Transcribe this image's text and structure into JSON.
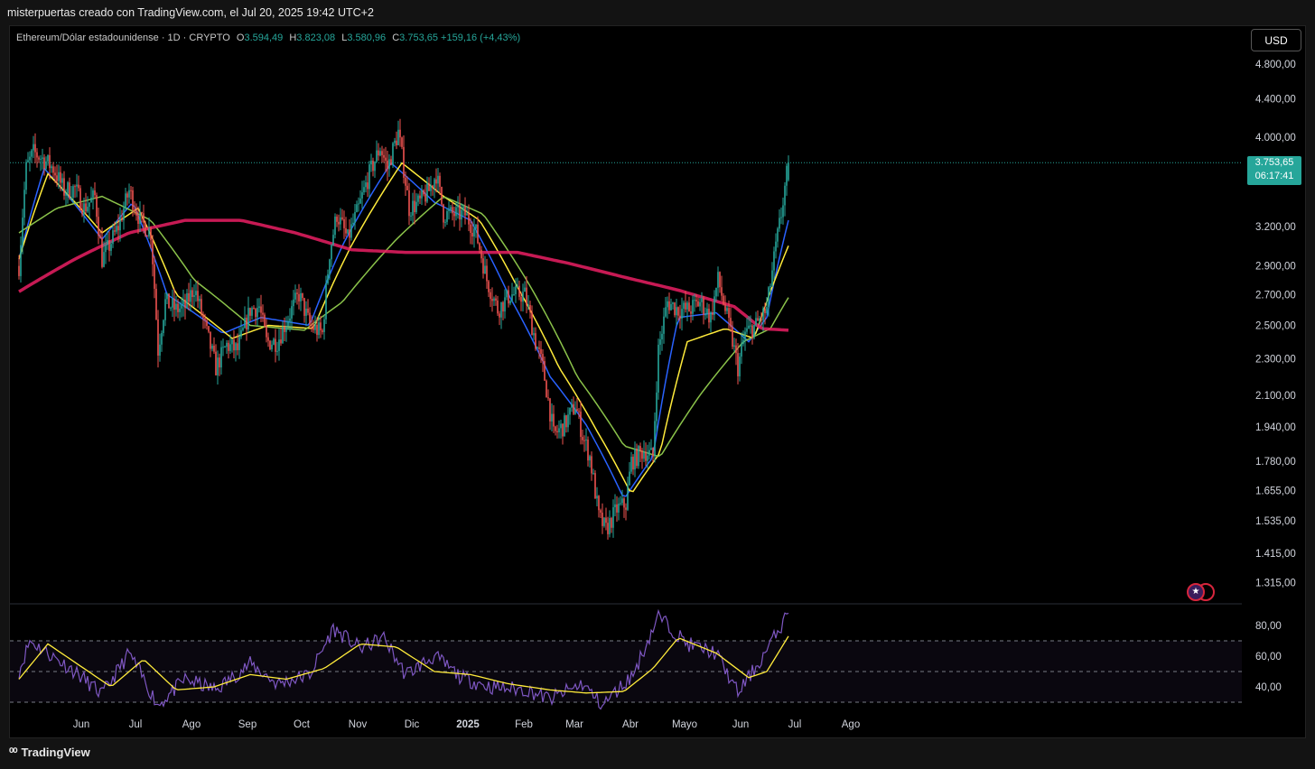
{
  "header": {
    "caption": "misterpuertas creado con TradingView.com, el Jul 20, 2025 19:42 UTC+2"
  },
  "legend": {
    "symbol": "Ethereum/Dólar estadounidense · 1D · CRYPTO",
    "open_key": "O",
    "open": "3.594,49",
    "high_key": "H",
    "high": "3.823,08",
    "low_key": "L",
    "low": "3.580,96",
    "close_key": "C",
    "close": "3.753,65",
    "change": "+159,16 (+4,43%)"
  },
  "toolbar": {
    "currency_label": "USD"
  },
  "last_price": {
    "price": "3.753,65",
    "countdown": "06:17:41",
    "color": "#26a69a"
  },
  "footer": {
    "brand": "TradingView"
  },
  "icons": {
    "event_flag": "us-flag-icon",
    "brand_mark": "tradingview-logo-icon"
  },
  "colors": {
    "up": "#26a69a",
    "down": "#ef5350",
    "ma_fast": "#2962ff",
    "ma_mid": "#ffeb3b",
    "ma_slow": "#8bc34a",
    "ma_long": "#e91e63",
    "rsi": "#7e57c2",
    "rsi_ma": "#ffeb3b"
  },
  "chart_data": {
    "type": "candlestick",
    "price_scale": "log",
    "y_ticks": [
      "4.800,00",
      "4.400,00",
      "4.000,00",
      "3.200,00",
      "2.900,00",
      "2.700,00",
      "2.500,00",
      "2.300,00",
      "2.100,00",
      "1.940,00",
      "1.780,00",
      "1.655,00",
      "1.535,00",
      "1.415,00",
      "1.315,00"
    ],
    "y_tick_values": [
      4800,
      4400,
      4000,
      3200,
      2900,
      2700,
      2500,
      2300,
      2100,
      1940,
      1780,
      1655,
      1535,
      1415,
      1315
    ],
    "x_ticks": [
      "Jun",
      "Jul",
      "Ago",
      "Sep",
      "Oct",
      "Nov",
      "Dic",
      "2025",
      "Feb",
      "Mar",
      "Abr",
      "Mayo",
      "Jun",
      "Jul",
      "Ago"
    ],
    "price_path": [
      [
        "2024-05-20",
        2900
      ],
      [
        "2024-05-24",
        3700
      ],
      [
        "2024-05-28",
        3850
      ],
      [
        "2024-06-03",
        3780
      ],
      [
        "2024-06-08",
        3700
      ],
      [
        "2024-06-14",
        3500
      ],
      [
        "2024-06-20",
        3520
      ],
      [
        "2024-06-25",
        3350
      ],
      [
        "2024-07-01",
        3450
      ],
      [
        "2024-07-05",
        2950
      ],
      [
        "2024-07-09",
        3050
      ],
      [
        "2024-07-14",
        3200
      ],
      [
        "2024-07-20",
        3500
      ],
      [
        "2024-07-26",
        3250
      ],
      [
        "2024-08-01",
        3150
      ],
      [
        "2024-08-05",
        2350
      ],
      [
        "2024-08-09",
        2650
      ],
      [
        "2024-08-15",
        2600
      ],
      [
        "2024-08-20",
        2620
      ],
      [
        "2024-08-25",
        2750
      ],
      [
        "2024-09-01",
        2450
      ],
      [
        "2024-09-06",
        2250
      ],
      [
        "2024-09-12",
        2380
      ],
      [
        "2024-09-18",
        2350
      ],
      [
        "2024-09-25",
        2600
      ],
      [
        "2024-09-30",
        2620
      ],
      [
        "2024-10-04",
        2400
      ],
      [
        "2024-10-10",
        2400
      ],
      [
        "2024-10-16",
        2550
      ],
      [
        "2024-10-22",
        2700
      ],
      [
        "2024-10-28",
        2500
      ],
      [
        "2024-11-04",
        2450
      ],
      [
        "2024-11-08",
        3000
      ],
      [
        "2024-11-12",
        3300
      ],
      [
        "2024-11-18",
        3100
      ],
      [
        "2024-11-24",
        3350
      ],
      [
        "2024-11-30",
        3650
      ],
      [
        "2024-12-06",
        3900
      ],
      [
        "2024-12-10",
        3700
      ],
      [
        "2024-12-16",
        4050
      ],
      [
        "2024-12-22",
        3350
      ],
      [
        "2024-12-28",
        3400
      ],
      [
        "2025-01-02",
        3500
      ],
      [
        "2025-01-06",
        3650
      ],
      [
        "2025-01-10",
        3300
      ],
      [
        "2025-01-16",
        3300
      ],
      [
        "2025-01-22",
        3300
      ],
      [
        "2025-01-28",
        3150
      ],
      [
        "2025-02-03",
        2800
      ],
      [
        "2025-02-09",
        2600
      ],
      [
        "2025-02-16",
        2700
      ],
      [
        "2025-02-24",
        2700
      ],
      [
        "2025-03-02",
        2400
      ],
      [
        "2025-03-06",
        2250
      ],
      [
        "2025-03-12",
        1900
      ],
      [
        "2025-03-18",
        1950
      ],
      [
        "2025-03-24",
        2050
      ],
      [
        "2025-03-28",
        1900
      ],
      [
        "2025-04-01",
        1800
      ],
      [
        "2025-04-06",
        1550
      ],
      [
        "2025-04-10",
        1500
      ],
      [
        "2025-04-16",
        1580
      ],
      [
        "2025-04-21",
        1600
      ],
      [
        "2025-04-24",
        1780
      ],
      [
        "2025-05-01",
        1830
      ],
      [
        "2025-05-06",
        1800
      ],
      [
        "2025-05-09",
        2350
      ],
      [
        "2025-05-14",
        2650
      ],
      [
        "2025-05-20",
        2600
      ],
      [
        "2025-05-26",
        2600
      ],
      [
        "2025-06-01",
        2650
      ],
      [
        "2025-06-07",
        2550
      ],
      [
        "2025-06-11",
        2800
      ],
      [
        "2025-06-17",
        2500
      ],
      [
        "2025-06-22",
        2250
      ],
      [
        "2025-06-26",
        2450
      ],
      [
        "2025-07-02",
        2500
      ],
      [
        "2025-07-08",
        2600
      ],
      [
        "2025-07-12",
        2950
      ],
      [
        "2025-07-16",
        3300
      ],
      [
        "2025-07-20",
        3753.65
      ]
    ],
    "moving_averages": [
      {
        "color": "#2962ff",
        "path": [
          [
            "2024-05-20",
            2950
          ],
          [
            "2024-06-03",
            3700
          ],
          [
            "2024-07-05",
            3100
          ],
          [
            "2024-07-22",
            3400
          ],
          [
            "2024-08-10",
            2700
          ],
          [
            "2024-09-10",
            2450
          ],
          [
            "2024-10-01",
            2550
          ],
          [
            "2024-10-28",
            2500
          ],
          [
            "2024-11-15",
            3050
          ],
          [
            "2024-12-12",
            3750
          ],
          [
            "2025-01-05",
            3400
          ],
          [
            "2025-01-25",
            3250
          ],
          [
            "2025-02-15",
            2700
          ],
          [
            "2025-03-10",
            2200
          ],
          [
            "2025-03-30",
            1950
          ],
          [
            "2025-04-20",
            1620
          ],
          [
            "2025-05-06",
            1800
          ],
          [
            "2025-05-20",
            2550
          ],
          [
            "2025-06-10",
            2580
          ],
          [
            "2025-06-28",
            2400
          ],
          [
            "2025-07-08",
            2550
          ],
          [
            "2025-07-20",
            3250
          ]
        ]
      },
      {
        "color": "#ffeb3b",
        "path": [
          [
            "2024-05-20",
            2950
          ],
          [
            "2024-06-05",
            3650
          ],
          [
            "2024-07-05",
            3150
          ],
          [
            "2024-07-25",
            3350
          ],
          [
            "2024-08-15",
            2700
          ],
          [
            "2024-09-15",
            2420
          ],
          [
            "2024-10-05",
            2500
          ],
          [
            "2024-10-30",
            2480
          ],
          [
            "2024-11-20",
            3050
          ],
          [
            "2024-12-18",
            3750
          ],
          [
            "2025-01-10",
            3450
          ],
          [
            "2025-01-30",
            3250
          ],
          [
            "2025-02-20",
            2750
          ],
          [
            "2025-03-15",
            2250
          ],
          [
            "2025-04-05",
            1920
          ],
          [
            "2025-04-24",
            1640
          ],
          [
            "2025-05-10",
            1820
          ],
          [
            "2025-05-25",
            2400
          ],
          [
            "2025-06-15",
            2480
          ],
          [
            "2025-07-01",
            2420
          ],
          [
            "2025-07-20",
            3050
          ]
        ]
      },
      {
        "color": "#8bc34a",
        "path": [
          [
            "2024-05-20",
            3150
          ],
          [
            "2024-06-10",
            3350
          ],
          [
            "2024-07-05",
            3450
          ],
          [
            "2024-08-01",
            3250
          ],
          [
            "2024-08-25",
            2800
          ],
          [
            "2024-09-25",
            2500
          ],
          [
            "2024-10-25",
            2470
          ],
          [
            "2024-11-15",
            2650
          ],
          [
            "2024-12-15",
            3100
          ],
          [
            "2025-01-10",
            3450
          ],
          [
            "2025-02-01",
            3300
          ],
          [
            "2025-02-25",
            2800
          ],
          [
            "2025-03-25",
            2200
          ],
          [
            "2025-04-20",
            1850
          ],
          [
            "2025-05-10",
            1800
          ],
          [
            "2025-06-01",
            2100
          ],
          [
            "2025-06-25",
            2400
          ],
          [
            "2025-07-10",
            2480
          ],
          [
            "2025-07-20",
            2680
          ]
        ]
      },
      {
        "color": "#e91e63",
        "path": [
          [
            "2024-05-20",
            2720
          ],
          [
            "2024-06-20",
            2950
          ],
          [
            "2024-07-20",
            3150
          ],
          [
            "2024-08-20",
            3250
          ],
          [
            "2024-09-20",
            3250
          ],
          [
            "2024-10-20",
            3150
          ],
          [
            "2024-11-20",
            3020
          ],
          [
            "2024-12-20",
            3000
          ],
          [
            "2025-01-20",
            3000
          ],
          [
            "2025-02-20",
            3000
          ],
          [
            "2025-03-20",
            2920
          ],
          [
            "2025-04-20",
            2820
          ],
          [
            "2025-05-20",
            2730
          ],
          [
            "2025-06-20",
            2620
          ],
          [
            "2025-07-05",
            2480
          ],
          [
            "2025-07-20",
            2470
          ]
        ]
      }
    ],
    "rsi": {
      "y_ticks": [
        "80,00",
        "60,00",
        "40,00"
      ],
      "y_tick_values": [
        80,
        60,
        40
      ],
      "bands": [
        70,
        50,
        30
      ],
      "path": [
        [
          "2024-05-20",
          50
        ],
        [
          "2024-05-26",
          70
        ],
        [
          "2024-06-05",
          62
        ],
        [
          "2024-06-20",
          50
        ],
        [
          "2024-07-05",
          35
        ],
        [
          "2024-07-20",
          62
        ],
        [
          "2024-08-05",
          28
        ],
        [
          "2024-08-20",
          45
        ],
        [
          "2024-09-06",
          38
        ],
        [
          "2024-09-25",
          55
        ],
        [
          "2024-10-10",
          42
        ],
        [
          "2024-10-28",
          48
        ],
        [
          "2024-11-10",
          78
        ],
        [
          "2024-11-25",
          65
        ],
        [
          "2024-12-08",
          72
        ],
        [
          "2024-12-20",
          48
        ],
        [
          "2025-01-05",
          60
        ],
        [
          "2025-01-20",
          46
        ],
        [
          "2025-02-05",
          40
        ],
        [
          "2025-02-25",
          38
        ],
        [
          "2025-03-10",
          32
        ],
        [
          "2025-03-28",
          42
        ],
        [
          "2025-04-08",
          28
        ],
        [
          "2025-04-25",
          48
        ],
        [
          "2025-05-09",
          86
        ],
        [
          "2025-05-25",
          68
        ],
        [
          "2025-06-10",
          62
        ],
        [
          "2025-06-22",
          36
        ],
        [
          "2025-07-05",
          58
        ],
        [
          "2025-07-20",
          88
        ]
      ],
      "ma_path": [
        [
          "2024-05-20",
          45
        ],
        [
          "2024-06-05",
          68
        ],
        [
          "2024-06-25",
          52
        ],
        [
          "2024-07-10",
          40
        ],
        [
          "2024-07-28",
          58
        ],
        [
          "2024-08-15",
          38
        ],
        [
          "2024-09-05",
          40
        ],
        [
          "2024-09-25",
          48
        ],
        [
          "2024-10-15",
          45
        ],
        [
          "2024-11-05",
          52
        ],
        [
          "2024-11-25",
          68
        ],
        [
          "2024-12-15",
          66
        ],
        [
          "2025-01-05",
          50
        ],
        [
          "2025-01-25",
          48
        ],
        [
          "2025-02-15",
          42
        ],
        [
          "2025-03-10",
          38
        ],
        [
          "2025-03-30",
          36
        ],
        [
          "2025-04-20",
          37
        ],
        [
          "2025-05-06",
          52
        ],
        [
          "2025-05-20",
          72
        ],
        [
          "2025-06-10",
          62
        ],
        [
          "2025-06-28",
          46
        ],
        [
          "2025-07-08",
          50
        ],
        [
          "2025-07-20",
          73
        ]
      ]
    }
  }
}
